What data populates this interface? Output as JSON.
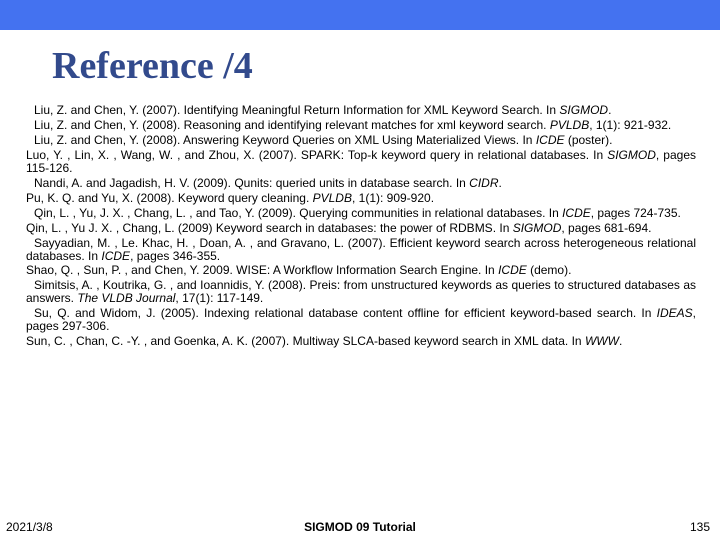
{
  "title": "Reference /4",
  "refs": [
    {
      "text_before": " Liu, Z. and Chen, Y. (2007). Identifying Meaningful Return Information for XML Keyword Search. In ",
      "venue": "SIGMOD",
      "text_after": "."
    },
    {
      "text_before": " Liu, Z. and Chen, Y. (2008). Reasoning and identifying relevant matches for xml keyword search. ",
      "venue": "PVLDB",
      "text_after": ", 1(1): 921-932."
    },
    {
      "text_before": " Liu, Z. and Chen, Y. (2008). Answering Keyword Queries on XML Using Materialized Views. In ",
      "venue": "ICDE",
      "text_after": " (poster)."
    },
    {
      "text_before": "Luo, Y. , Lin, X. , Wang, W. , and Zhou, X. (2007). SPARK: Top-k keyword query in relational databases. In ",
      "venue": "SIGMOD",
      "text_after": ", pages 115-126.",
      "no_indent": true
    },
    {
      "text_before": " Nandi, A. and Jagadish, H. V. (2009). Qunits: queried units in database search. In ",
      "venue": "CIDR",
      "text_after": "."
    },
    {
      "text_before": "Pu, K. Q. and Yu, X. (2008). Keyword query cleaning. ",
      "venue": "PVLDB",
      "text_after": ", 1(1): 909-920.",
      "no_indent": true
    },
    {
      "text_before": " Qin, L. , Yu, J. X. , Chang, L. , and Tao, Y. (2009). Querying communities in relational databases. In ",
      "venue": "ICDE",
      "text_after": ", pages 724-735."
    },
    {
      "text_before": "Qin, L. , Yu J. X. , Chang, L. (2009) Keyword search in databases: the power of RDBMS. In ",
      "venue": "SIGMOD",
      "text_after": ", pages 681-694.",
      "no_indent": true
    },
    {
      "text_before": " Sayyadian, M. , Le. Khac, H. , Doan, A. , and Gravano, L. (2007). Efficient keyword search across heterogeneous relational databases. In ",
      "venue": "ICDE",
      "text_after": ", pages 346-355."
    },
    {
      "text_before": "Shao, Q. , Sun, P. , and Chen, Y. 2009. WISE: A Workflow Information Search Engine. In ",
      "venue": "ICDE",
      "text_after": " (demo).",
      "no_indent": true
    },
    {
      "text_before": " Simitsis, A. , Koutrika, G. , and Ioannidis, Y. (2008). Preis: from unstructured keywords as queries to structured databases as answers. ",
      "venue": "The VLDB Journal",
      "text_after": ", 17(1): 117-149."
    },
    {
      "text_before": " Su, Q. and Widom, J. (2005). Indexing relational database content offline for efficient keyword-based search. In ",
      "venue": "IDEAS",
      "text_after": ", pages 297-306."
    },
    {
      "text_before": "Sun, C. , Chan, C. -Y. , and Goenka, A. K. (2007). Multiway SLCA-based keyword search in XML data. In ",
      "venue": "WWW",
      "text_after": ".",
      "no_indent": true
    }
  ],
  "footer": {
    "date": "2021/3/8",
    "center": "SIGMOD 09 Tutorial",
    "page": "135"
  }
}
